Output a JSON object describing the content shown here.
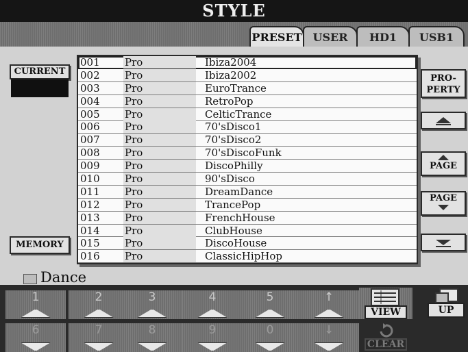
{
  "window": {
    "title": "STYLE"
  },
  "tabs": [
    {
      "label": "PRESET",
      "active": true
    },
    {
      "label": "USER",
      "active": false
    },
    {
      "label": "HD1",
      "active": false
    },
    {
      "label": "USB1",
      "active": false
    }
  ],
  "left_panel": {
    "current_label": "CURRENT",
    "memory_label": "MEMORY"
  },
  "right_panel": {
    "property_line1": "PRO-",
    "property_line2": "PERTY",
    "page_label": "PAGE"
  },
  "style_list": [
    {
      "num": "001",
      "category": "Pro",
      "name": "Ibiza2004"
    },
    {
      "num": "002",
      "category": "Pro",
      "name": "Ibiza2002"
    },
    {
      "num": "003",
      "category": "Pro",
      "name": "EuroTrance"
    },
    {
      "num": "004",
      "category": "Pro",
      "name": "RetroPop"
    },
    {
      "num": "005",
      "category": "Pro",
      "name": "CelticTrance"
    },
    {
      "num": "006",
      "category": "Pro",
      "name": "70'sDisco1"
    },
    {
      "num": "007",
      "category": "Pro",
      "name": "70'sDisco2"
    },
    {
      "num": "008",
      "category": "Pro",
      "name": "70'sDiscoFunk"
    },
    {
      "num": "009",
      "category": "Pro",
      "name": "DiscoPhilly"
    },
    {
      "num": "010",
      "category": "Pro",
      "name": "90'sDisco"
    },
    {
      "num": "011",
      "category": "Pro",
      "name": "DreamDance"
    },
    {
      "num": "012",
      "category": "Pro",
      "name": "TrancePop"
    },
    {
      "num": "013",
      "category": "Pro",
      "name": "FrenchHouse"
    },
    {
      "num": "014",
      "category": "Pro",
      "name": "ClubHouse"
    },
    {
      "num": "015",
      "category": "Pro",
      "name": "DiscoHouse"
    },
    {
      "num": "016",
      "category": "Pro",
      "name": "ClassicHipHop"
    }
  ],
  "folder": {
    "name": "Dance",
    "icon": "folder-icon"
  },
  "bottom_upper": [
    {
      "label": "1"
    },
    {
      "label": "2"
    },
    {
      "label": "3"
    },
    {
      "label": "4"
    },
    {
      "label": "5"
    },
    {
      "label": "↑"
    }
  ],
  "bottom_lower": [
    {
      "label": "6"
    },
    {
      "label": "7"
    },
    {
      "label": "8"
    },
    {
      "label": "9"
    },
    {
      "label": "0"
    },
    {
      "label": "↓"
    }
  ],
  "actions": {
    "view_label": "VIEW",
    "up_label": "UP",
    "clear_label": "CLEAR"
  }
}
